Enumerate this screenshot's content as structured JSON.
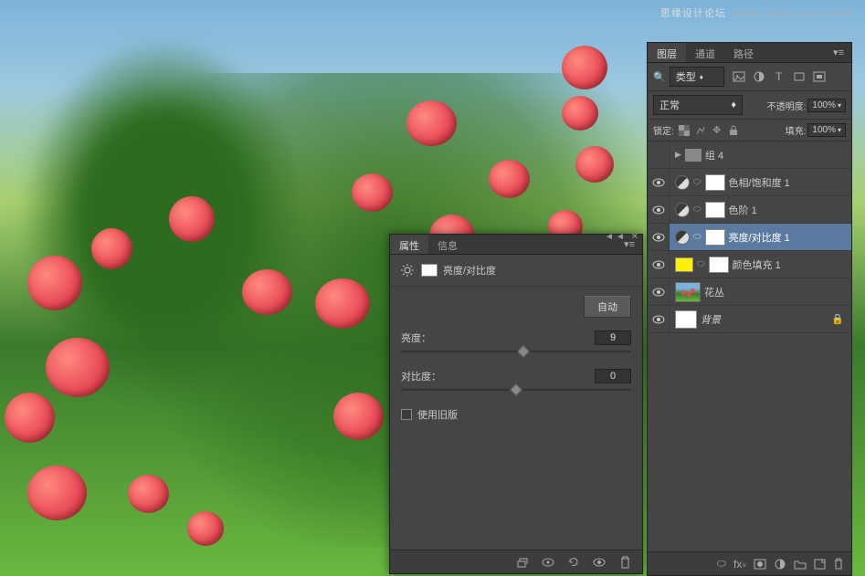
{
  "watermark": {
    "text1": "思缘设计论坛",
    "text2": "WWW.MISSYUAN.COM"
  },
  "properties": {
    "tabs": {
      "properties": "属性",
      "info": "信息"
    },
    "title": "亮度/对比度",
    "auto_label": "自动",
    "brightness": {
      "label": "亮度：",
      "value": "9",
      "pos": 53
    },
    "contrast": {
      "label": "对比度：",
      "value": "0",
      "pos": 50
    },
    "legacy_label": "使用旧版"
  },
  "layers": {
    "tabs": {
      "layers": "图层",
      "channels": "通道",
      "paths": "路径"
    },
    "filter_label": "类型",
    "blend_mode": "正常",
    "opacity_label": "不透明度:",
    "opacity_value": "100%",
    "lock_label": "锁定:",
    "fill_label": "填充:",
    "fill_value": "100%",
    "items": [
      {
        "name": "组 4",
        "type": "group"
      },
      {
        "name": "色相/饱和度 1",
        "type": "adjustment"
      },
      {
        "name": "色阶 1",
        "type": "adjustment"
      },
      {
        "name": "亮度/对比度 1",
        "type": "adjustment",
        "selected": true
      },
      {
        "name": "颜色填充 1",
        "type": "fill"
      },
      {
        "name": "花丛",
        "type": "image"
      },
      {
        "name": "背景",
        "type": "background"
      }
    ]
  }
}
